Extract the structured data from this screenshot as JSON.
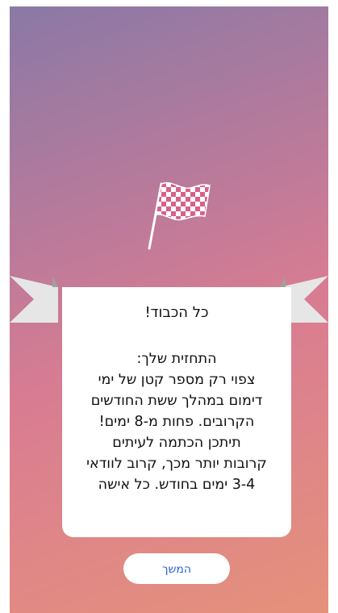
{
  "dialog": {
    "title": "כל הכבוד!",
    "body_lines": [
      "התחזית שלך:",
      "צפוי רק מספר קטן של ימי",
      "דימום במהלך ששת החודשים",
      "הקרובים. פחות מ-8 ימים!",
      "תיתכן הכתמה לעיתים",
      "קרובות יותר מכך, קרוב לוודאי",
      "3-4 ימים בחודש. כל אישה"
    ]
  },
  "continue_button": {
    "label": "המשך"
  },
  "icons": {
    "flag": "checkered-flag-icon"
  },
  "colors": {
    "gradient_top": "#8a79a6",
    "gradient_bottom": "#e4917a",
    "button_text": "#2f5fd0"
  }
}
